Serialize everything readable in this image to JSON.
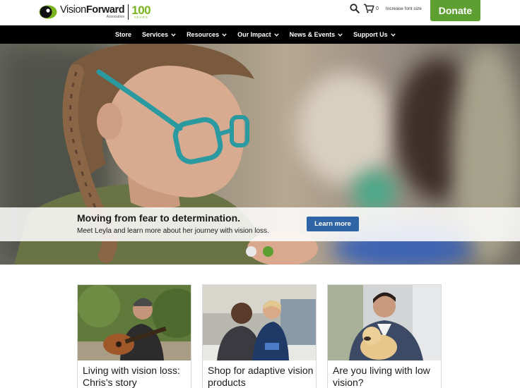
{
  "logo": {
    "word_light": "Vision",
    "word_bold": "Forward",
    "subtitle": "Association",
    "years": "100",
    "years_label": "YEARS"
  },
  "utility": {
    "search_icon": "search-icon",
    "cart_icon": "cart-icon",
    "cart_count": "0",
    "font_size_label": "Increase font size"
  },
  "donate_label": "Donate",
  "nav": {
    "items": [
      {
        "label": "Store",
        "has_dropdown": false
      },
      {
        "label": "Services",
        "has_dropdown": true
      },
      {
        "label": "Resources",
        "has_dropdown": true
      },
      {
        "label": "Our Impact",
        "has_dropdown": true
      },
      {
        "label": "News & Events",
        "has_dropdown": true
      },
      {
        "label": "Support Us",
        "has_dropdown": true
      }
    ]
  },
  "hero": {
    "title": "Moving from fear to determination.",
    "text": "Meet Leyla and learn more about her journey with vision loss.",
    "button_label": "Learn more",
    "slides": 2,
    "active_slide": 2
  },
  "cards": [
    {
      "title": "Living with vision loss: Chris’s story"
    },
    {
      "title": "Shop for adaptive vision products"
    },
    {
      "title": "Are you living with low vision?"
    }
  ],
  "colors": {
    "brand_green": "#5e9f32",
    "logo_green": "#7ab51d",
    "nav_bg": "#000000",
    "button_blue": "#2f64a6",
    "glasses_teal": "#2a9aa0"
  }
}
